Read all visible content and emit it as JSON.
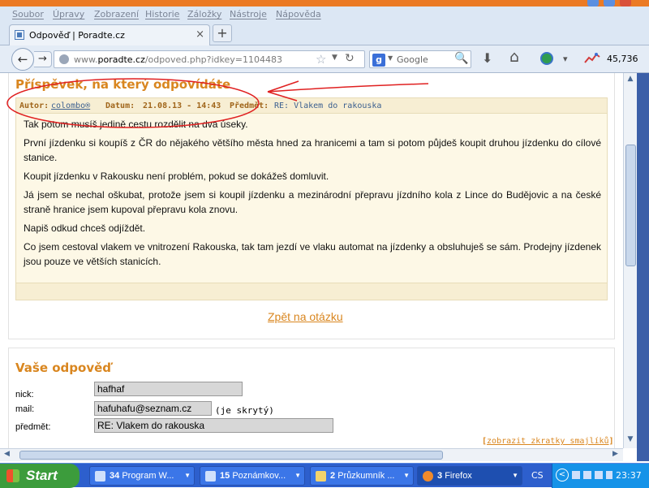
{
  "menu": [
    "Soubor",
    "Úpravy",
    "Zobrazení",
    "Historie",
    "Záložky",
    "Nástroje",
    "Nápověda"
  ],
  "tab": {
    "title": "Odpověď | Poradte.cz",
    "close": "×",
    "new_tab": "+"
  },
  "nav": {
    "back": "←",
    "forward": "→",
    "url_prefix": "www.",
    "url_domain": "poradte.cz",
    "url_path": "/odpoved.php?idkey=1104483",
    "search_placeholder": "Google",
    "search_engine_icon": "g",
    "alexa_rank": "45,736"
  },
  "icons": {
    "star": "☆",
    "reload": "↻",
    "dropdown": "▼",
    "magnifier": "🔍",
    "download": "⬇",
    "home": "⌂",
    "dropdown_small": "▾"
  },
  "post": {
    "heading": "Příspěvek, na který odpovídáte",
    "author_label": "Autor:",
    "author": "colombo®",
    "date_label": "Datum:",
    "date": "21.08.13 - 14:43",
    "subject_label": "Předmět:",
    "subject": "RE: Vlakem do rakouska",
    "paragraphs": [
      "Tak potom musíš jedině cestu rozdělit na dva úseky.",
      "První jízdenku si koupíš z ČR do nějakého většího města hned za hranicemi a tam si potom půjdeš koupit druhou jízdenku do cílové stanice.",
      "Koupit jízdenku v Rakousku není problém, pokud se dokážeš domluvit.",
      "Já jsem se nechal oškubat, protože jsem si koupil jízdenku a mezinárodní přepravu jízdního kola z Lince do Budějovic a na české straně hranice jsem kupoval přepravu kola znovu.",
      "Napiš odkud chceš odjíždět.",
      "Co jsem cestoval vlakem ve vnitrození Rakouska, tak tam jezdí ve vlaku automat na jízdenky a obsluhuješ se sám. Prodejny jízdenek jsou pouze ve větších stanicích."
    ],
    "back_link": "Zpět na otázku"
  },
  "form": {
    "heading": "Vaše odpověď",
    "nick_label": "nick:",
    "nick_value": "hafhaf",
    "mail_label": "mail:",
    "mail_value": "hafuhafu@seznam.cz",
    "mail_hint": "(je skrytý)",
    "subject_label": "předmět:",
    "subject_value": "RE: Vlakem do rakouska",
    "smileys_link": "zobrazit zkratky smajlíků",
    "bracket_open": "[",
    "bracket_close": "]"
  },
  "scroll": {
    "up": "▲",
    "down": "▼",
    "left": "◀",
    "right": "▶"
  },
  "taskbar": {
    "start": "Start",
    "tasks": [
      {
        "count": "34",
        "label": "Program W..."
      },
      {
        "count": "15",
        "label": "Poznámkov..."
      },
      {
        "count": "2",
        "label": "Průzkumník ..."
      },
      {
        "count": "3",
        "label": "Firefox"
      }
    ],
    "task_arrow": "▼",
    "lang": "CS",
    "expand": "<",
    "clock": "23:37"
  },
  "colors": {
    "accent": "#d9861f",
    "annotation": "#e02020",
    "taskbar": "#2d5fcd"
  }
}
